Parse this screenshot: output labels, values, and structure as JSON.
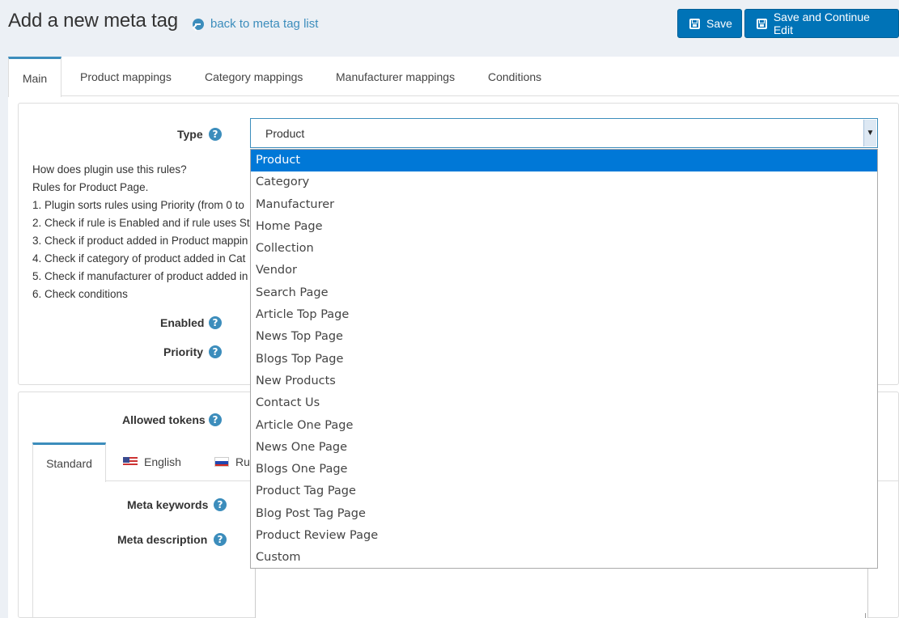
{
  "header": {
    "title": "Add a new meta tag",
    "back_link": "back to meta tag list",
    "save_label": "Save",
    "save_continue_label": "Save and Continue Edit"
  },
  "tabs": [
    {
      "label": "Main",
      "active": true
    },
    {
      "label": "Product mappings"
    },
    {
      "label": "Category mappings"
    },
    {
      "label": "Manufacturer mappings"
    },
    {
      "label": "Conditions"
    }
  ],
  "main": {
    "type_label": "Type",
    "type_value": "Product",
    "help_lines": [
      "How does plugin use this rules?",
      "Rules for Product Page.",
      "1. Plugin sorts rules using Priority (from 0 to",
      "2. Check if rule is Enabled and if rule uses St",
      "3. Check if product added in Product mappin",
      "4. Check if category of product added in Cat",
      "5. Check if manufacturer of product added in",
      "6. Check conditions"
    ],
    "enabled_label": "Enabled",
    "priority_label": "Priority"
  },
  "type_options": [
    "Product",
    "Category",
    "Manufacturer",
    "Home Page",
    "Collection",
    "Vendor",
    "Search Page",
    "Article Top Page",
    "News Top Page",
    "Blogs Top Page",
    "New Products",
    "Contact Us",
    "Article One Page",
    "News One Page",
    "Blogs One Page",
    "Product Tag Page",
    "Blog Post Tag Page",
    "Product Review Page",
    "Custom"
  ],
  "tokens": {
    "allowed_tokens_label": "Allowed tokens",
    "lang_tabs": [
      {
        "label": "Standard",
        "active": true
      },
      {
        "label": "English",
        "flag": "us-flag-icon"
      },
      {
        "label": "Ru",
        "flag": "ru-flag-icon"
      }
    ],
    "meta_keywords_label": "Meta keywords",
    "meta_description_label": "Meta description"
  },
  "colors": {
    "accent": "#3c8dbc",
    "button": "#0073b7",
    "selected_option": "#0078d7"
  }
}
